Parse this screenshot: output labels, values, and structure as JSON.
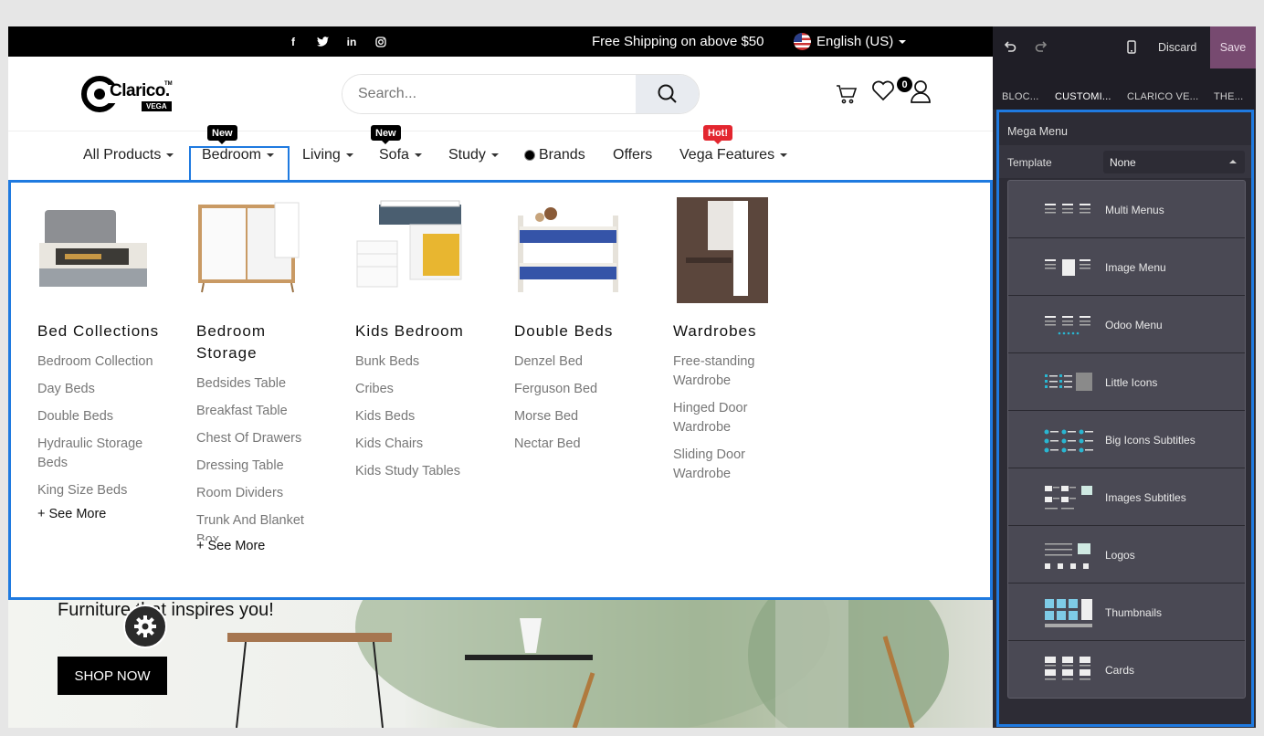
{
  "topbar": {
    "social_icons": [
      "facebook-icon",
      "twitter-icon",
      "linkedin-icon",
      "instagram-icon"
    ],
    "shipping": "Free Shipping on above $50",
    "language": "English (US)"
  },
  "header": {
    "logo_text": "Clarico.",
    "logo_tm": "TM",
    "logo_sub": "VEGA",
    "search_placeholder": "Search...",
    "wishlist_count": "0"
  },
  "nav": {
    "items": [
      {
        "label": "All Products"
      },
      {
        "label": "Bedroom",
        "badge": "New"
      },
      {
        "label": "Living"
      },
      {
        "label": "Sofa",
        "badge": "New"
      },
      {
        "label": "Study"
      },
      {
        "label": "Brands"
      },
      {
        "label": "Offers"
      },
      {
        "label": "Vega Features",
        "badge": "Hot!"
      }
    ]
  },
  "mega": {
    "columns": [
      {
        "title": "Bed Collections",
        "items": [
          "Bedroom Collection",
          "Day Beds",
          "Double Beds",
          "Hydraulic Storage Beds",
          "King Size Beds"
        ],
        "more": "+ See More"
      },
      {
        "title": "Bedroom Storage",
        "items": [
          "Bedsides Table",
          "Breakfast Table",
          "Chest Of Drawers",
          "Dressing Table",
          "Room Dividers",
          "Trunk And Blanket Box"
        ],
        "more": "+ See More"
      },
      {
        "title": "Kids Bedroom",
        "items": [
          "Bunk Beds",
          "Cribes",
          "Kids Beds",
          "Kids Chairs",
          "Kids Study Tables"
        ]
      },
      {
        "title": "Double Beds",
        "items": [
          "Denzel Bed",
          "Ferguson Bed",
          "Morse Bed",
          "Nectar Bed"
        ]
      },
      {
        "title": "Wardrobes",
        "items": [
          "Free-standing Wardrobe",
          "Hinged Door Wardrobe",
          "Sliding Door Wardrobe"
        ]
      }
    ]
  },
  "hero": {
    "tagline": "Furniture that inspires you!",
    "cta": "SHOP NOW"
  },
  "editor": {
    "discard": "Discard",
    "save": "Save",
    "tabs": [
      "BLOC...",
      "CUSTOMI...",
      "CLARICO VE...",
      "THE..."
    ],
    "section_title": "Mega Menu",
    "template_label": "Template",
    "template_value": "None",
    "options": [
      "Multi Menus",
      "Image Menu",
      "Odoo Menu",
      "Little Icons",
      "Big Icons Subtitles",
      "Images Subtitles",
      "Logos",
      "Thumbnails",
      "Cards"
    ]
  },
  "colors": {
    "selection": "#1f7ae0",
    "save_bg": "#774a70",
    "hot_badge": "#e3262f",
    "panel_bg": "#2d2c35"
  }
}
